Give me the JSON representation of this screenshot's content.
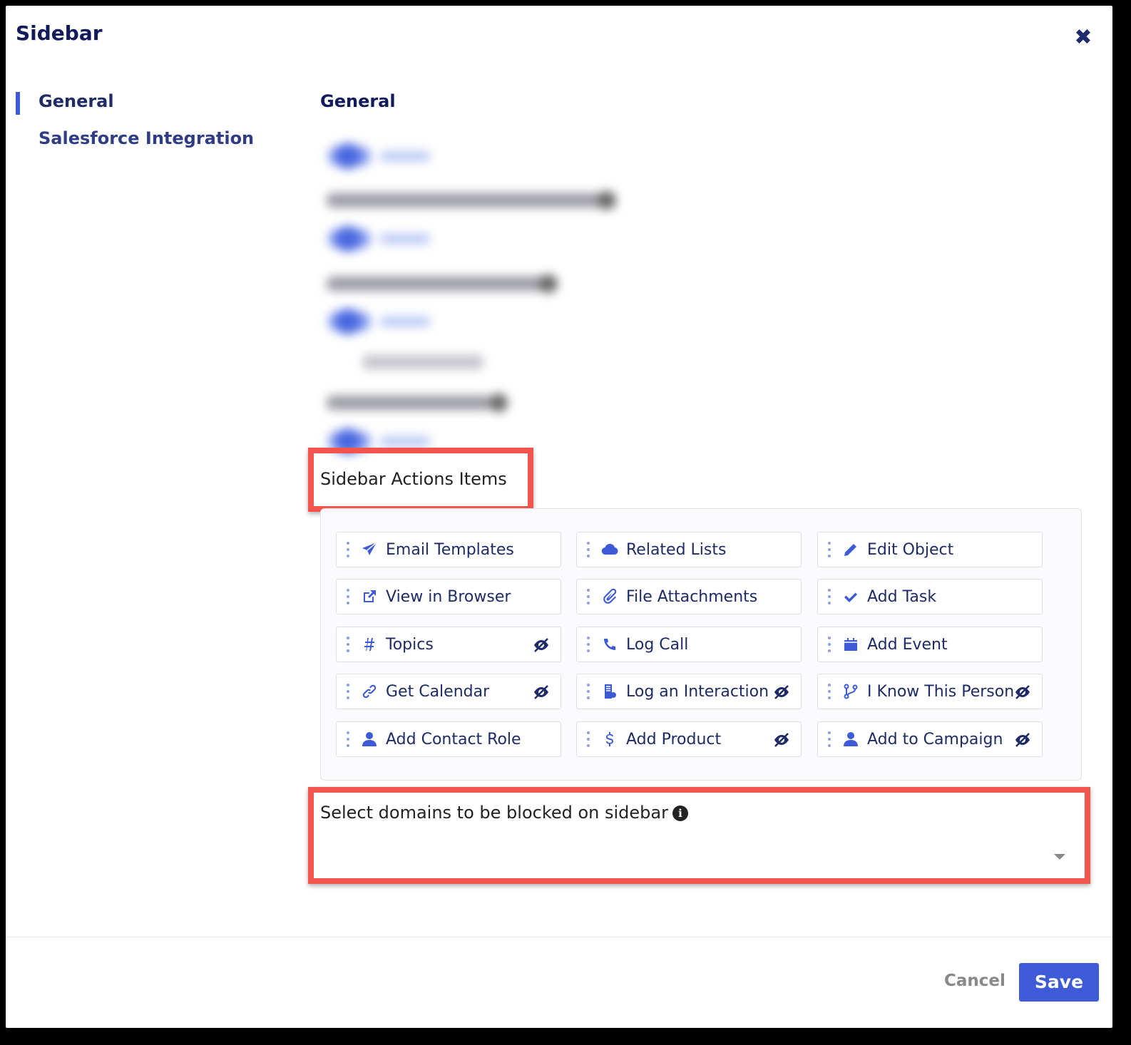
{
  "dialog": {
    "title": "Sidebar",
    "close_icon": "close-icon"
  },
  "nav": {
    "items": [
      {
        "label": "General",
        "active": true
      },
      {
        "label": "Salesforce Integration",
        "active": false
      }
    ]
  },
  "main": {
    "section_title": "General",
    "actions_label": "Sidebar Actions Items",
    "actions": [
      {
        "label": "Email Templates",
        "icon": "paper-plane-icon",
        "hidden": false
      },
      {
        "label": "Related Lists",
        "icon": "cloud-icon",
        "hidden": false
      },
      {
        "label": "Edit Object",
        "icon": "pencil-icon",
        "hidden": false
      },
      {
        "label": "View in Browser",
        "icon": "external-link-icon",
        "hidden": false
      },
      {
        "label": "File Attachments",
        "icon": "paperclip-icon",
        "hidden": false
      },
      {
        "label": "Add Task",
        "icon": "check-icon",
        "hidden": false
      },
      {
        "label": "Topics",
        "icon": "hashtag-icon",
        "hidden": true
      },
      {
        "label": "Log Call",
        "icon": "phone-icon",
        "hidden": false
      },
      {
        "label": "Add Event",
        "icon": "calendar-icon",
        "hidden": false
      },
      {
        "label": "Get Calendar",
        "icon": "link-icon",
        "hidden": true
      },
      {
        "label": "Log an Interaction",
        "icon": "report-icon",
        "hidden": true
      },
      {
        "label": "I Know This Person",
        "icon": "branch-icon",
        "hidden": true
      },
      {
        "label": "Add Contact Role",
        "icon": "user-icon",
        "hidden": false
      },
      {
        "label": "Add Product",
        "icon": "dollar-icon",
        "hidden": true
      },
      {
        "label": "Add to Campaign",
        "icon": "user-icon",
        "hidden": true
      }
    ],
    "domains_label": "Select domains to be blocked on sidebar",
    "domains_value": ""
  },
  "footer": {
    "cancel_label": "Cancel",
    "save_label": "Save"
  },
  "colors": {
    "accent": "#3d5bd6",
    "highlight": "#f1554d",
    "text_dark": "#1e2b66"
  }
}
